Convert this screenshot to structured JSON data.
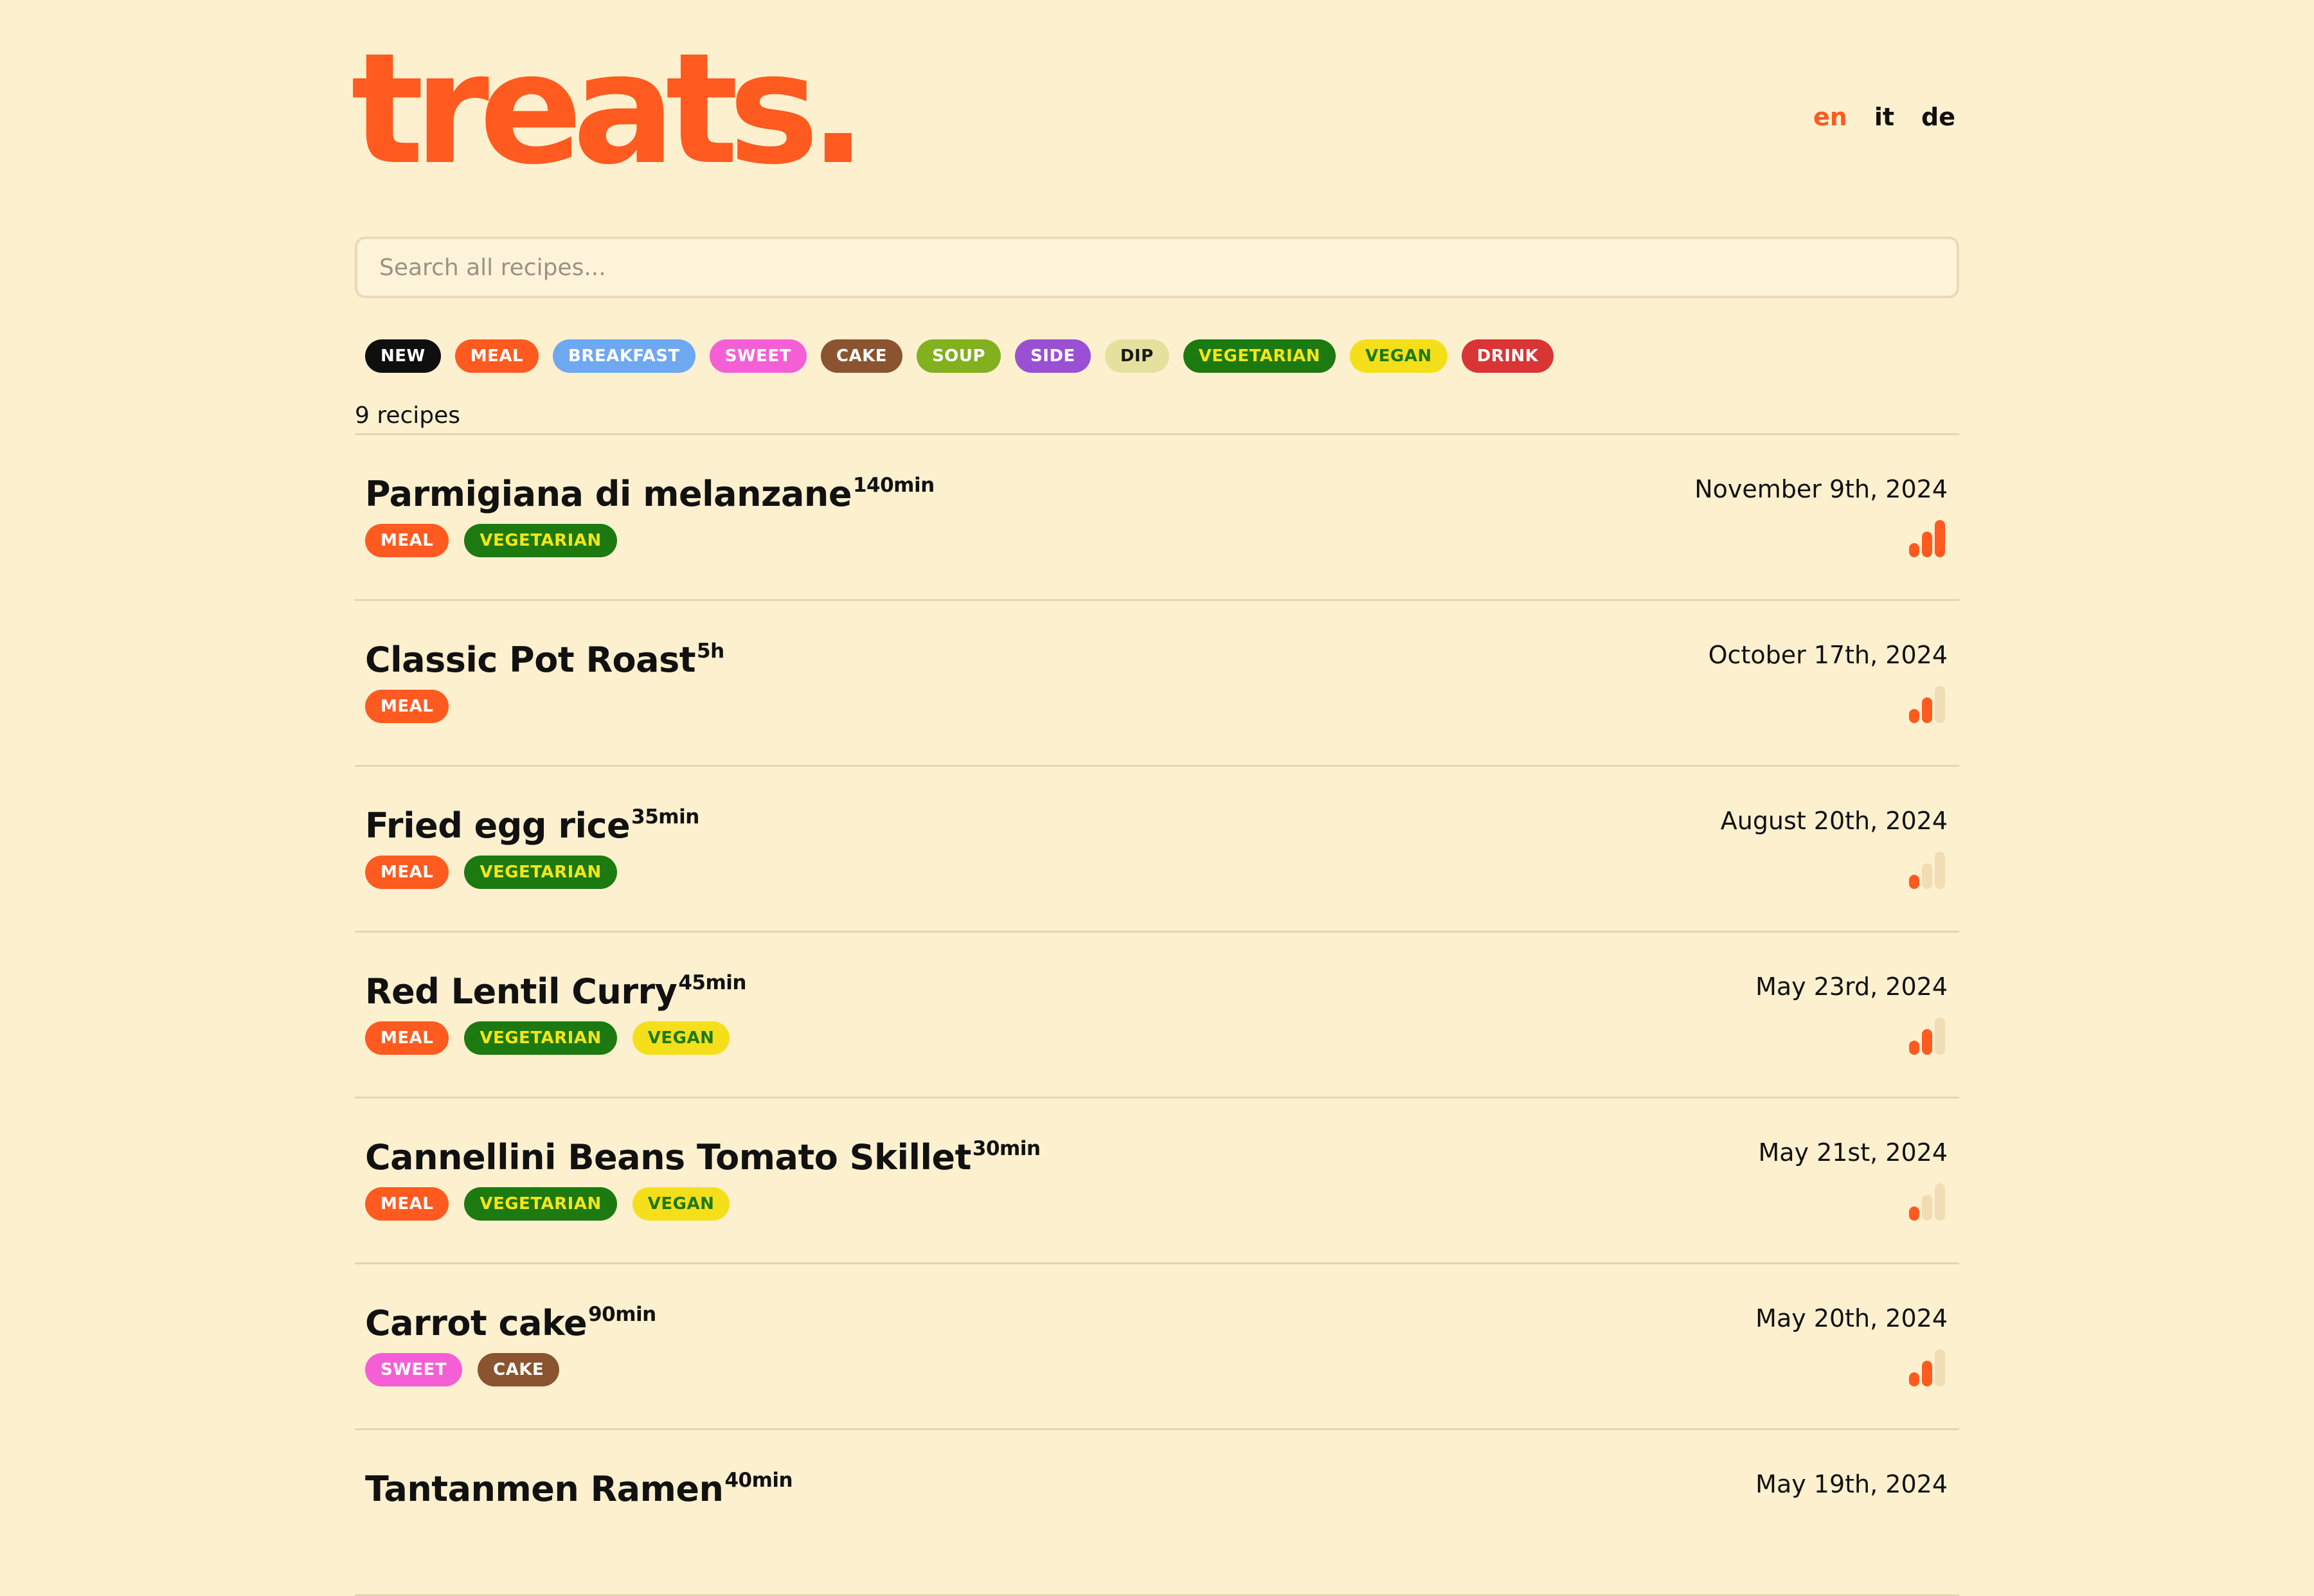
{
  "brand": "treats.",
  "languages": [
    {
      "code": "en",
      "active": true
    },
    {
      "code": "it",
      "active": false
    },
    {
      "code": "de",
      "active": false
    }
  ],
  "search": {
    "placeholder": "Search all recipes..."
  },
  "filters": [
    {
      "label": "NEW",
      "bg": "#0f0f0f",
      "fg": "#ffffff"
    },
    {
      "label": "MEAL",
      "bg": "#ff5a1f",
      "fg": "#ffffff"
    },
    {
      "label": "BREAKFAST",
      "bg": "#6ea8f0",
      "fg": "#ffffff"
    },
    {
      "label": "SWEET",
      "bg": "#f55fd6",
      "fg": "#ffffff"
    },
    {
      "label": "CAKE",
      "bg": "#8a5430",
      "fg": "#ffffff"
    },
    {
      "label": "SOUP",
      "bg": "#82b01e",
      "fg": "#ffffff"
    },
    {
      "label": "SIDE",
      "bg": "#9a50d3",
      "fg": "#ffffff"
    },
    {
      "label": "DIP",
      "bg": "#e4e09e",
      "fg": "#1a1a1a"
    },
    {
      "label": "VEGETARIAN",
      "bg": "#1c7a10",
      "fg": "#f5e51a"
    },
    {
      "label": "VEGAN",
      "bg": "#f5df1a",
      "fg": "#1c7a10"
    },
    {
      "label": "DRINK",
      "bg": "#d93535",
      "fg": "#ffffff"
    }
  ],
  "count_label": "9 recipes",
  "tag_colors": {
    "MEAL": {
      "bg": "#ff5a1f",
      "fg": "#ffffff"
    },
    "VEGETARIAN": {
      "bg": "#1c7a10",
      "fg": "#f5e51a"
    },
    "VEGAN": {
      "bg": "#f5df1a",
      "fg": "#1c7a10"
    },
    "SWEET": {
      "bg": "#f55fd6",
      "fg": "#ffffff"
    },
    "CAKE": {
      "bg": "#8a5430",
      "fg": "#ffffff"
    }
  },
  "difficulty_colors": {
    "on": "#ff5a1f",
    "off": "#f0ddb4"
  },
  "recipes": [
    {
      "title": "Parmigiana di melanzane",
      "time": "140min",
      "date": "November 9th, 2024",
      "tags": [
        "MEAL",
        "VEGETARIAN"
      ],
      "difficulty": 3
    },
    {
      "title": "Classic Pot Roast",
      "time": "5h",
      "date": "October 17th, 2024",
      "tags": [
        "MEAL"
      ],
      "difficulty": 2
    },
    {
      "title": "Fried egg rice",
      "time": "35min",
      "date": "August 20th, 2024",
      "tags": [
        "MEAL",
        "VEGETARIAN"
      ],
      "difficulty": 1
    },
    {
      "title": "Red Lentil Curry",
      "time": "45min",
      "date": "May 23rd, 2024",
      "tags": [
        "MEAL",
        "VEGETARIAN",
        "VEGAN"
      ],
      "difficulty": 2
    },
    {
      "title": "Cannellini Beans Tomato Skillet",
      "time": "30min",
      "date": "May 21st, 2024",
      "tags": [
        "MEAL",
        "VEGETARIAN",
        "VEGAN"
      ],
      "difficulty": 1
    },
    {
      "title": "Carrot cake",
      "time": "90min",
      "date": "May 20th, 2024",
      "tags": [
        "SWEET",
        "CAKE"
      ],
      "difficulty": 2
    },
    {
      "title": "Tantanmen Ramen",
      "time": "40min",
      "date": "May 19th, 2024",
      "tags": [],
      "difficulty": 0
    }
  ]
}
